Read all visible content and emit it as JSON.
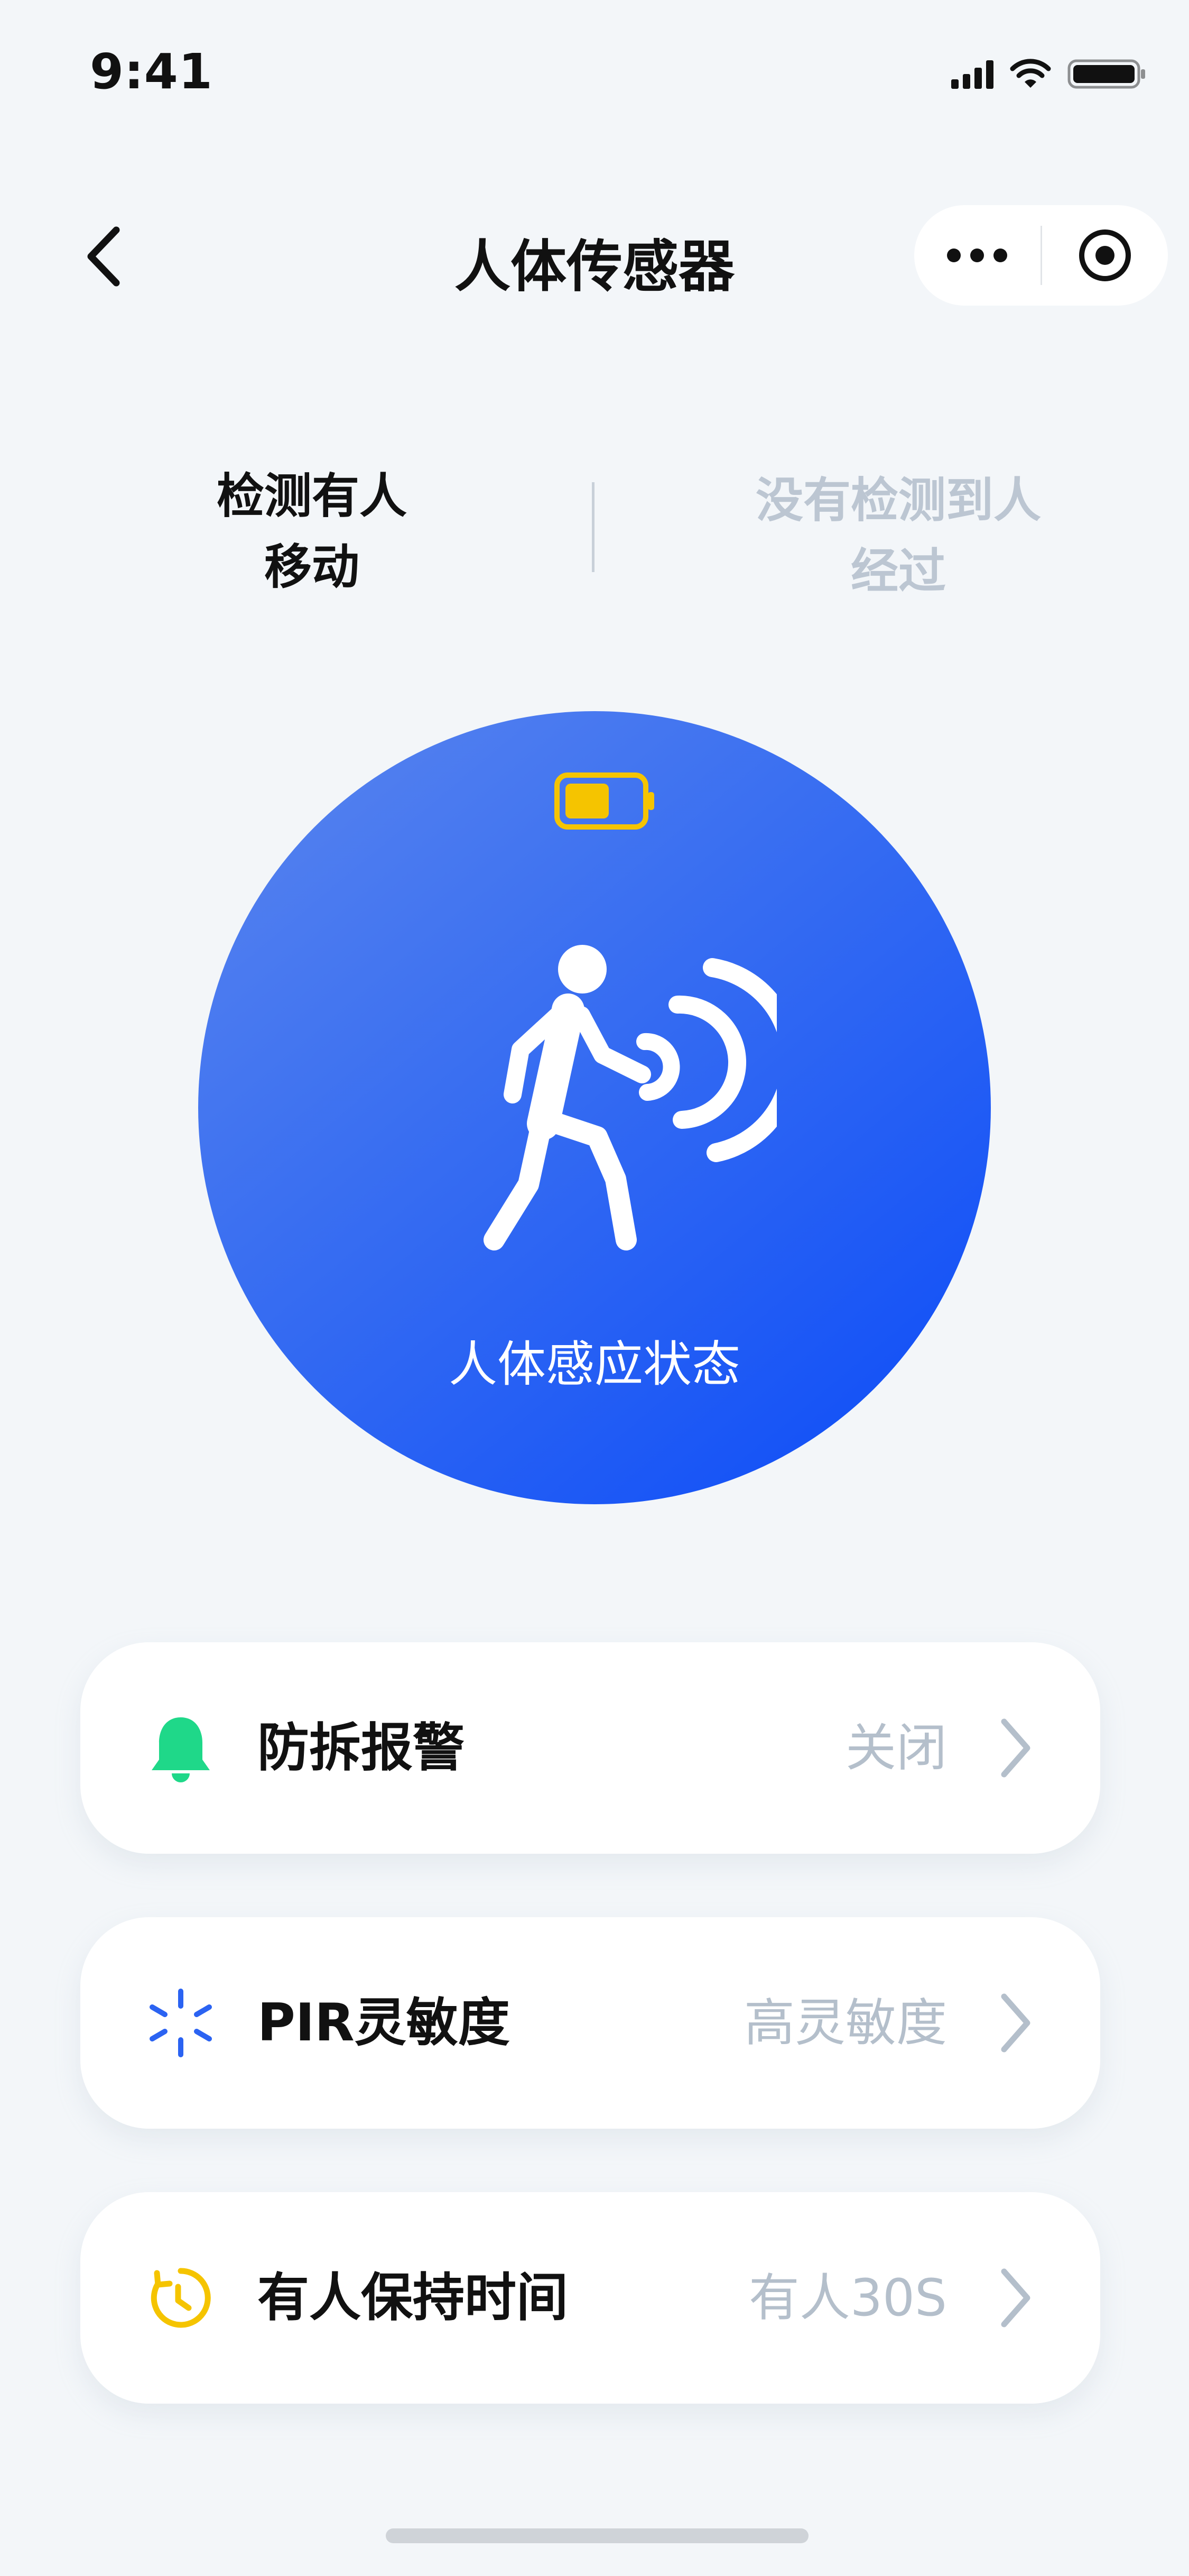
{
  "status_bar": {
    "time": "9:41"
  },
  "nav": {
    "title": "人体传感器"
  },
  "detection": {
    "active_line1": "检测有人",
    "active_line2": "移动",
    "inactive_line1": "没有检测到人",
    "inactive_line2": "经过"
  },
  "sensor": {
    "label": "人体感应状态",
    "battery_level": 0.6
  },
  "settings": [
    {
      "label": "防拆报警",
      "value": "关闭",
      "icon": "bell-icon"
    },
    {
      "label": "PIR灵敏度",
      "value": "高灵敏度",
      "icon": "sensitivity-icon"
    },
    {
      "label": "有人保持时间",
      "value": "有人30S",
      "icon": "timer-icon"
    }
  ],
  "colors": {
    "accent_blue": "#1e5af6",
    "bell_green": "#1fd889",
    "sensitivity_blue": "#2b63f2",
    "timer_yellow": "#f5c400",
    "battery_yellow": "#f5c400"
  }
}
